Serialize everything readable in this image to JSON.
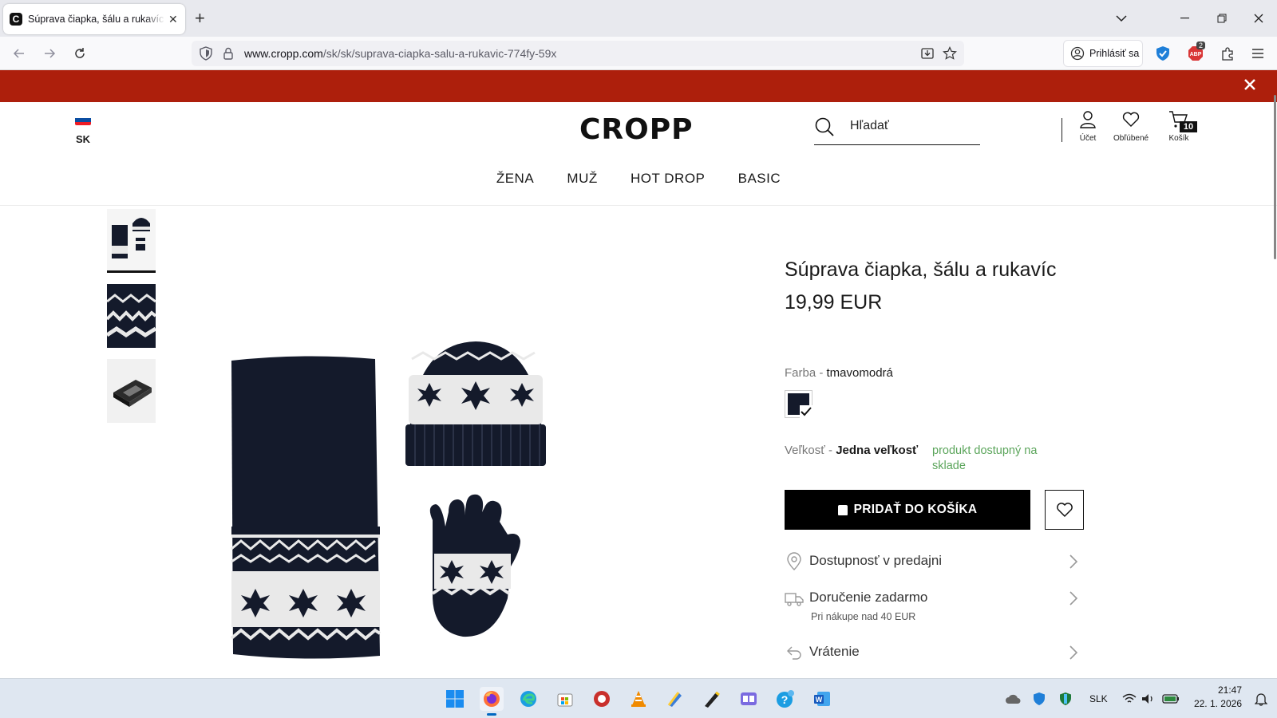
{
  "browser": {
    "tab_title": "Súprava čiapka, šálu a rukavíc F",
    "tab_favicon_letter": "C",
    "url_host": "www.cropp.com",
    "url_path": "/sk/sk/suprava-ciapka-salu-a-rukavic-774fy-59x",
    "signin_label": "Prihlásiť sa",
    "abp_badge": "2"
  },
  "site": {
    "country_code": "SK",
    "logo": "CROPP",
    "search_placeholder": "Hľadať",
    "account_label": "Účet",
    "favorites_label": "Obľúbené",
    "cart_label": "Košík",
    "cart_count": "10",
    "promo_color": "#ad1f0c",
    "nav": [
      "ŽENA",
      "MUŽ",
      "HOT DROP",
      "BASIC"
    ]
  },
  "product": {
    "title": "Súprava čiapka, šálu a rukavíc",
    "price": "19,99 EUR",
    "color_label": "Farba - ",
    "color_value": "tmavomodrá",
    "size_label": "Veľkosť - ",
    "size_value": "Jedna veľkosť",
    "stock_status": "produkt dostupný na sklade",
    "add_to_cart": "PRIDAŤ DO KOŠÍKA",
    "info_rows": [
      {
        "label": "Dostupnosť v predajni",
        "sub": ""
      },
      {
        "label": "Doručenie zadarmo",
        "sub": "Pri nákupe nad 40 EUR"
      },
      {
        "label": "Vrátenie",
        "sub": ""
      }
    ],
    "colors": {
      "navy": "#141a2b",
      "stock_green": "#5ba55b"
    }
  },
  "taskbar": {
    "language": "SLK",
    "time": "21:47",
    "date": "22. 1. 2026"
  }
}
